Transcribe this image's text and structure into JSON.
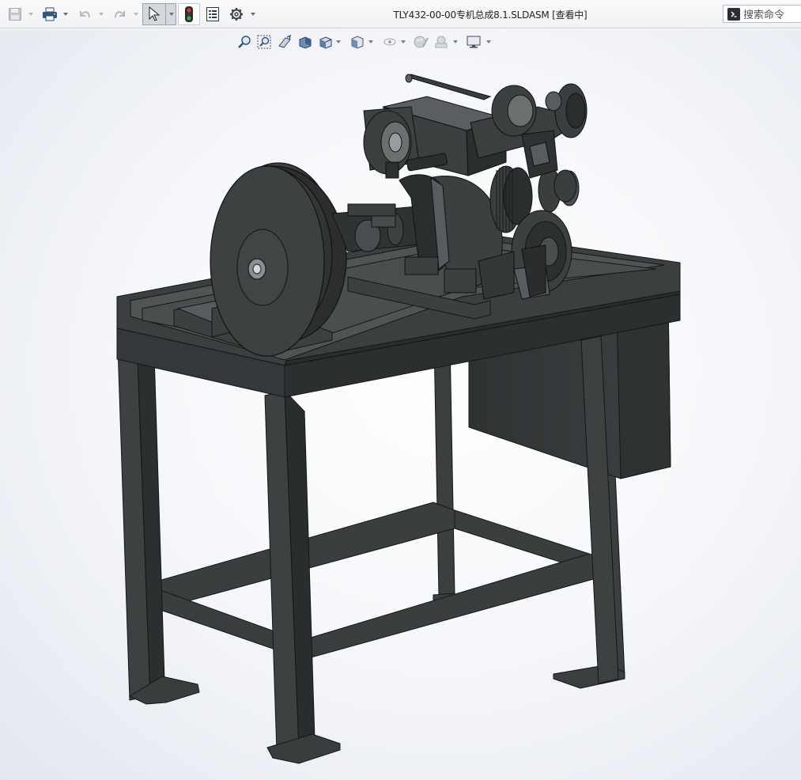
{
  "window": {
    "title_prefix": "TLY432-00-00",
    "title_chinese": "专机总成",
    "title_suffix": "8.1.SLDASM [",
    "title_mode": "查看中",
    "title_end": "]"
  },
  "search": {
    "placeholder": "搜索命令"
  },
  "icons": {
    "save": "save-icon",
    "print": "print-icon",
    "undo": "undo-icon",
    "redo": "redo-icon",
    "select": "cursor-arrow-icon",
    "rebuild": "traffic-light-icon",
    "file_properties": "file-properties-icon",
    "options": "gear-icon",
    "command": "terminal-icon",
    "view": [
      "zoom-to-fit-icon",
      "zoom-to-area-icon",
      "previous-view-icon",
      "section-view-icon",
      "view-orientation-icon",
      "display-style-icon",
      "hide-show-items-icon",
      "edit-appearance-icon",
      "apply-scene-icon",
      "view-settings-icon"
    ]
  },
  "colors": {
    "model_body": "#3a3d3e",
    "model_dark": "#2a2c2d",
    "model_light": "#585c5e",
    "toolbar_bg": "#f4f5f7",
    "select_active": "#d5d8dc"
  }
}
